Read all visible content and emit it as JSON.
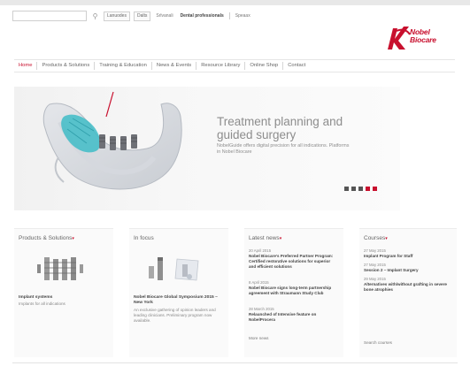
{
  "utility": {
    "search_placeholder": "",
    "select1": "Lanuodes",
    "select2": "Dalts",
    "link1": "Srlvanali",
    "link2": "Dental professionals",
    "link3": "Speaax"
  },
  "logo": {
    "line1": "Nobel",
    "line2": "Biocare"
  },
  "nav": {
    "items": [
      "Home",
      "Products & Solutions",
      "Training & Education",
      "News & Events",
      "Resource Library",
      "Online Shop",
      "Contact"
    ]
  },
  "hero": {
    "title_line1": "Treatment planning and",
    "title_line2": "guided surgery",
    "subtitle": "NobelGuide offers digital precision for all indications. Platforms in Nobel Biocare"
  },
  "boxes": {
    "products": {
      "title": "Products & Solutions",
      "item_title": "Implant systems",
      "item_desc": "Implants for all indications"
    },
    "in_focus": {
      "title": "In focus",
      "item_title": "Nobel Biocare Global Symposium 2015 – New York",
      "item_desc": "An exclusive gathering of opinion leaders and leading clinicians. Preliminary program now available."
    },
    "news": {
      "title": "Latest news",
      "items": [
        {
          "date": "20 April 2015",
          "title": "Nobel Biocare's Preferred Partner Program: Certified restorative solutions for superior and efficient solutions"
        },
        {
          "date": "8 April 2015",
          "title": "Nobel Biocare signs long-term partnership agreement with Straumann Study Club"
        },
        {
          "date": "28 March 2015",
          "title": "Relaunched of Intensive feature on NobelProcera"
        }
      ],
      "more": "More news"
    },
    "courses": {
      "title": "Courses",
      "items": [
        {
          "date": "27 May 2015",
          "title": "Implant Program for Staff"
        },
        {
          "date": "27 May 2015",
          "title": "Session 2 – Implant Surgery"
        },
        {
          "date": "29 May 2015",
          "title": "Alternatives with/without grafting in severe bone atrophies"
        }
      ],
      "more": "Search courses"
    }
  },
  "colors": {
    "accent": "#c8102e",
    "text": "#444444",
    "muted": "#888888"
  },
  "icons": {
    "search": "search-icon",
    "logo": "nobel-logo-mark"
  }
}
